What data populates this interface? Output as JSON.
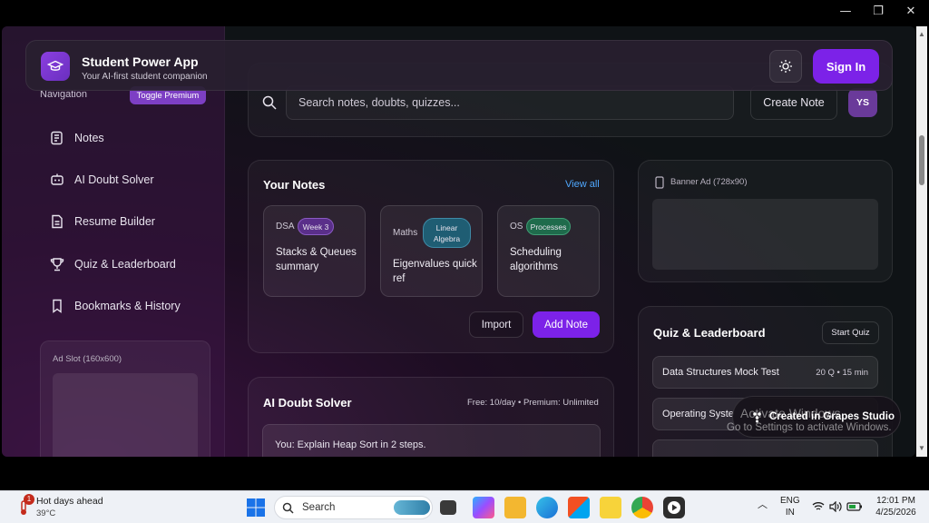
{
  "window": {
    "minimize": "—",
    "maximize": "❐",
    "close": "✕"
  },
  "app": {
    "title": "Student Power App",
    "subtitle": "Your AI-first student companion",
    "signin_label": "Sign In"
  },
  "sidebar": {
    "nav_label": "Navigation",
    "toggle_premium": "Toggle Premium",
    "items": [
      {
        "label": "Notes",
        "icon": "notes-icon"
      },
      {
        "label": "AI Doubt Solver",
        "icon": "robot-icon"
      },
      {
        "label": "Resume Builder",
        "icon": "document-icon"
      },
      {
        "label": "Quiz & Leaderboard",
        "icon": "trophy-icon"
      },
      {
        "label": "Bookmarks & History",
        "icon": "bookmark-icon"
      }
    ],
    "ad_slot": "Ad Slot (160x600)"
  },
  "search": {
    "placeholder": "Search notes, doubts, quizzes...",
    "create_note": "Create Note",
    "avatar": "YS"
  },
  "notes": {
    "title": "Your Notes",
    "view_all": "View all",
    "items": [
      {
        "subject": "DSA",
        "tag": "Week 3",
        "title": "Stacks & Queues summary",
        "tag_color": "#5a2f8a"
      },
      {
        "subject": "Maths",
        "tag": "Linear Algebra",
        "title": "Eigenvalues quick ref",
        "tag_color": "#1f5d73"
      },
      {
        "subject": "OS",
        "tag": "Processes",
        "title": "Scheduling algorithms",
        "tag_color": "#1f6b4c"
      }
    ],
    "import": "Import",
    "add_note": "Add Note"
  },
  "banner": {
    "label": "Banner Ad (728x90)"
  },
  "quiz": {
    "title": "Quiz & Leaderboard",
    "start": "Start Quiz",
    "items": [
      {
        "name": "Data Structures Mock Test",
        "meta": "20 Q • 15 min"
      },
      {
        "name": "Operating Syste",
        "meta": ""
      }
    ]
  },
  "doubt": {
    "title": "AI Doubt Solver",
    "meta": "Free: 10/day • Premium: Unlimited",
    "message": "You: Explain Heap Sort in 2 steps."
  },
  "overlay": {
    "toast": "Created in Grapes Studio",
    "activate_title": "Activate Windows",
    "activate_sub": "Go to Settings to activate Windows."
  },
  "taskbar": {
    "weather_title": "Hot days ahead",
    "weather_temp": "39°C",
    "weather_badge": "1",
    "search": "Search",
    "lang_top": "ENG",
    "lang_bottom": "IN",
    "time": "12:01 PM",
    "date": "4/25/2026"
  },
  "colors": {
    "accent": "#7c22e8",
    "link": "#4fa8ff"
  }
}
